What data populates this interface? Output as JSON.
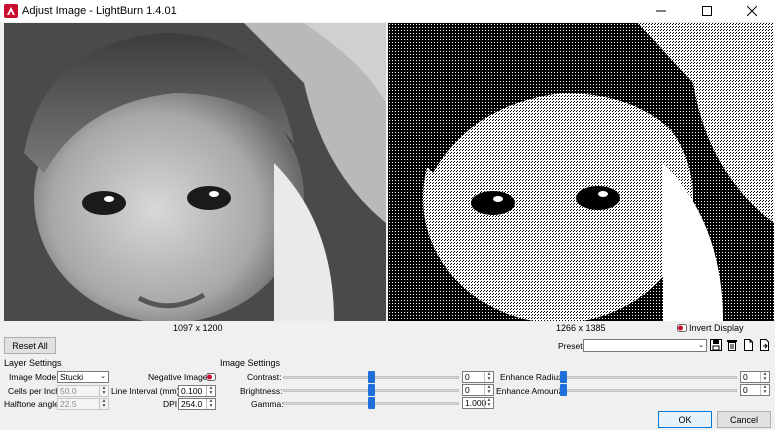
{
  "window": {
    "title": "Adjust Image - LightBurn 1.4.01",
    "minimize_icon": "minimize-icon",
    "maximize_icon": "maximize-icon",
    "close_icon": "close-icon"
  },
  "images": {
    "original_dimensions": "1097 x 1200",
    "preview_dimensions": "1266 x 1385",
    "invert_display_label": "Invert Display"
  },
  "toolbar": {
    "reset_all_label": "Reset All",
    "presets_label": "Presets",
    "presets_value": "",
    "preset_icons": [
      "save-icon",
      "trash-icon",
      "new-document-icon",
      "import-document-icon"
    ]
  },
  "layer_settings": {
    "title": "Layer Settings",
    "image_mode_label": "Image Mode:",
    "image_mode_value": "Stucki",
    "cells_per_inch_label": "Cells per Inch",
    "cells_per_inch_value": "50.0",
    "halftone_angle_label": "Halftone angle",
    "halftone_angle_value": "22.5",
    "negative_image_label": "Negative Image",
    "line_interval_label": "Line Interval (mm)",
    "line_interval_value": "0.100",
    "dpi_label": "DPI",
    "dpi_value": "254.0"
  },
  "image_settings": {
    "title": "Image Settings",
    "contrast_label": "Contrast:",
    "contrast_value": "0",
    "brightness_label": "Brightness:",
    "brightness_value": "0",
    "gamma_label": "Gamma:",
    "gamma_value": "1.000",
    "enhance_radius_label": "Enhance Radius:",
    "enhance_radius_value": "0",
    "enhance_amount_label": "Enhance Amount:",
    "enhance_amount_value": "0"
  },
  "dialog": {
    "ok_label": "OK",
    "cancel_label": "Cancel"
  },
  "colors": {
    "accent": "#1e6fd9",
    "app_logo": "#c8102e"
  }
}
